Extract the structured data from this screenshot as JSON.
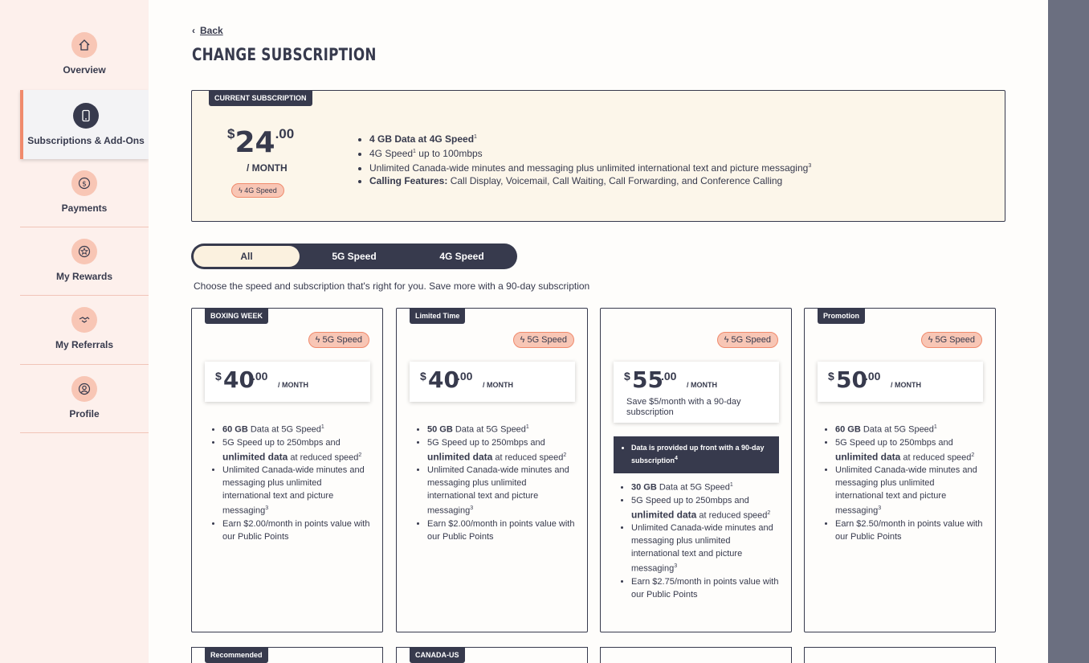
{
  "sidebar": {
    "items": [
      {
        "label": "Overview",
        "icon": "home-icon"
      },
      {
        "label": "Subscriptions & Add-Ons",
        "icon": "phone-icon",
        "active": true
      },
      {
        "label": "Payments",
        "icon": "dollar-icon"
      },
      {
        "label": "My Rewards",
        "icon": "star-icon"
      },
      {
        "label": "My Referrals",
        "icon": "handshake-icon"
      },
      {
        "label": "Profile",
        "icon": "user-icon"
      }
    ]
  },
  "header": {
    "back_label": "Back",
    "title": "CHANGE SUBSCRIPTION"
  },
  "current": {
    "tag": "CURRENT SUBSCRIPTION",
    "price_dollar": "$",
    "price_whole": "24",
    "price_cents": ".00",
    "per_month": "/ MONTH",
    "speed": "4G Speed",
    "features": [
      {
        "bold": "4 GB Data at 4G Speed",
        "sup": "1",
        "text": ""
      },
      {
        "bold": "",
        "text": "4G Speed",
        "sup": "1",
        "text2": " up to 100mbps"
      },
      {
        "bold": "",
        "text": "Unlimited Canada-wide minutes and messaging plus unlimited international text and picture messaging",
        "sup": "3"
      },
      {
        "bold": "Calling Features:",
        "text": " Call Display, Voicemail, Call Waiting, Call Forwarding, and Conference Calling"
      }
    ]
  },
  "filter": {
    "options": [
      "All",
      "5G Speed",
      "4G Speed"
    ],
    "selected": "All"
  },
  "subtitle": "Choose the speed and subscription that's right for you. Save more with a 90-day subscription",
  "plans": [
    {
      "tag": "BOXING WEEK",
      "speed": "5G Speed",
      "price_whole": "40",
      "price_cents": ".00",
      "per_month": "/ MONTH",
      "data_gb": "60 GB",
      "earn": "Earn $2.00/month in points value with our Public Points"
    },
    {
      "tag": "Limited Time",
      "speed": "5G Speed",
      "price_whole": "40",
      "price_cents": ".00",
      "per_month": "/ MONTH",
      "data_gb": "50 GB",
      "earn": "Earn $2.00/month in points value with our Public Points"
    },
    {
      "tag": "",
      "speed": "5G Speed",
      "price_whole": "55",
      "price_cents": ".00",
      "per_month": "/ MONTH",
      "note": "Save $5/month with a 90-day subscription",
      "dark_note": "Data is provided up front with a 90-day subscription",
      "dark_note_sup": "4",
      "data_gb": "30 GB",
      "earn": "Earn $2.75/month in points value with our Public Points"
    },
    {
      "tag": "Promotion",
      "speed": "5G Speed",
      "price_whole": "50",
      "price_cents": ".00",
      "per_month": "/ MONTH",
      "data_gb": "60 GB",
      "earn": "Earn $2.50/month in points value with our Public Points"
    }
  ],
  "plan_common": {
    "data_suffix": "Data at 5G Speed",
    "speed_line_a": "5G Speed up to 250mbps and",
    "speed_line_bold": "unlimited data",
    "speed_line_b": "at reduced speed",
    "minutes": "Unlimited Canada-wide minutes and messaging plus unlimited international text and picture messaging"
  },
  "bottom_tags": [
    "Recommended",
    "CANADA-US"
  ],
  "colors": {
    "dark": "#373a4d",
    "peach": "#f8c6b5",
    "accent": "#f08a6c",
    "cream": "#fcf6ea"
  }
}
